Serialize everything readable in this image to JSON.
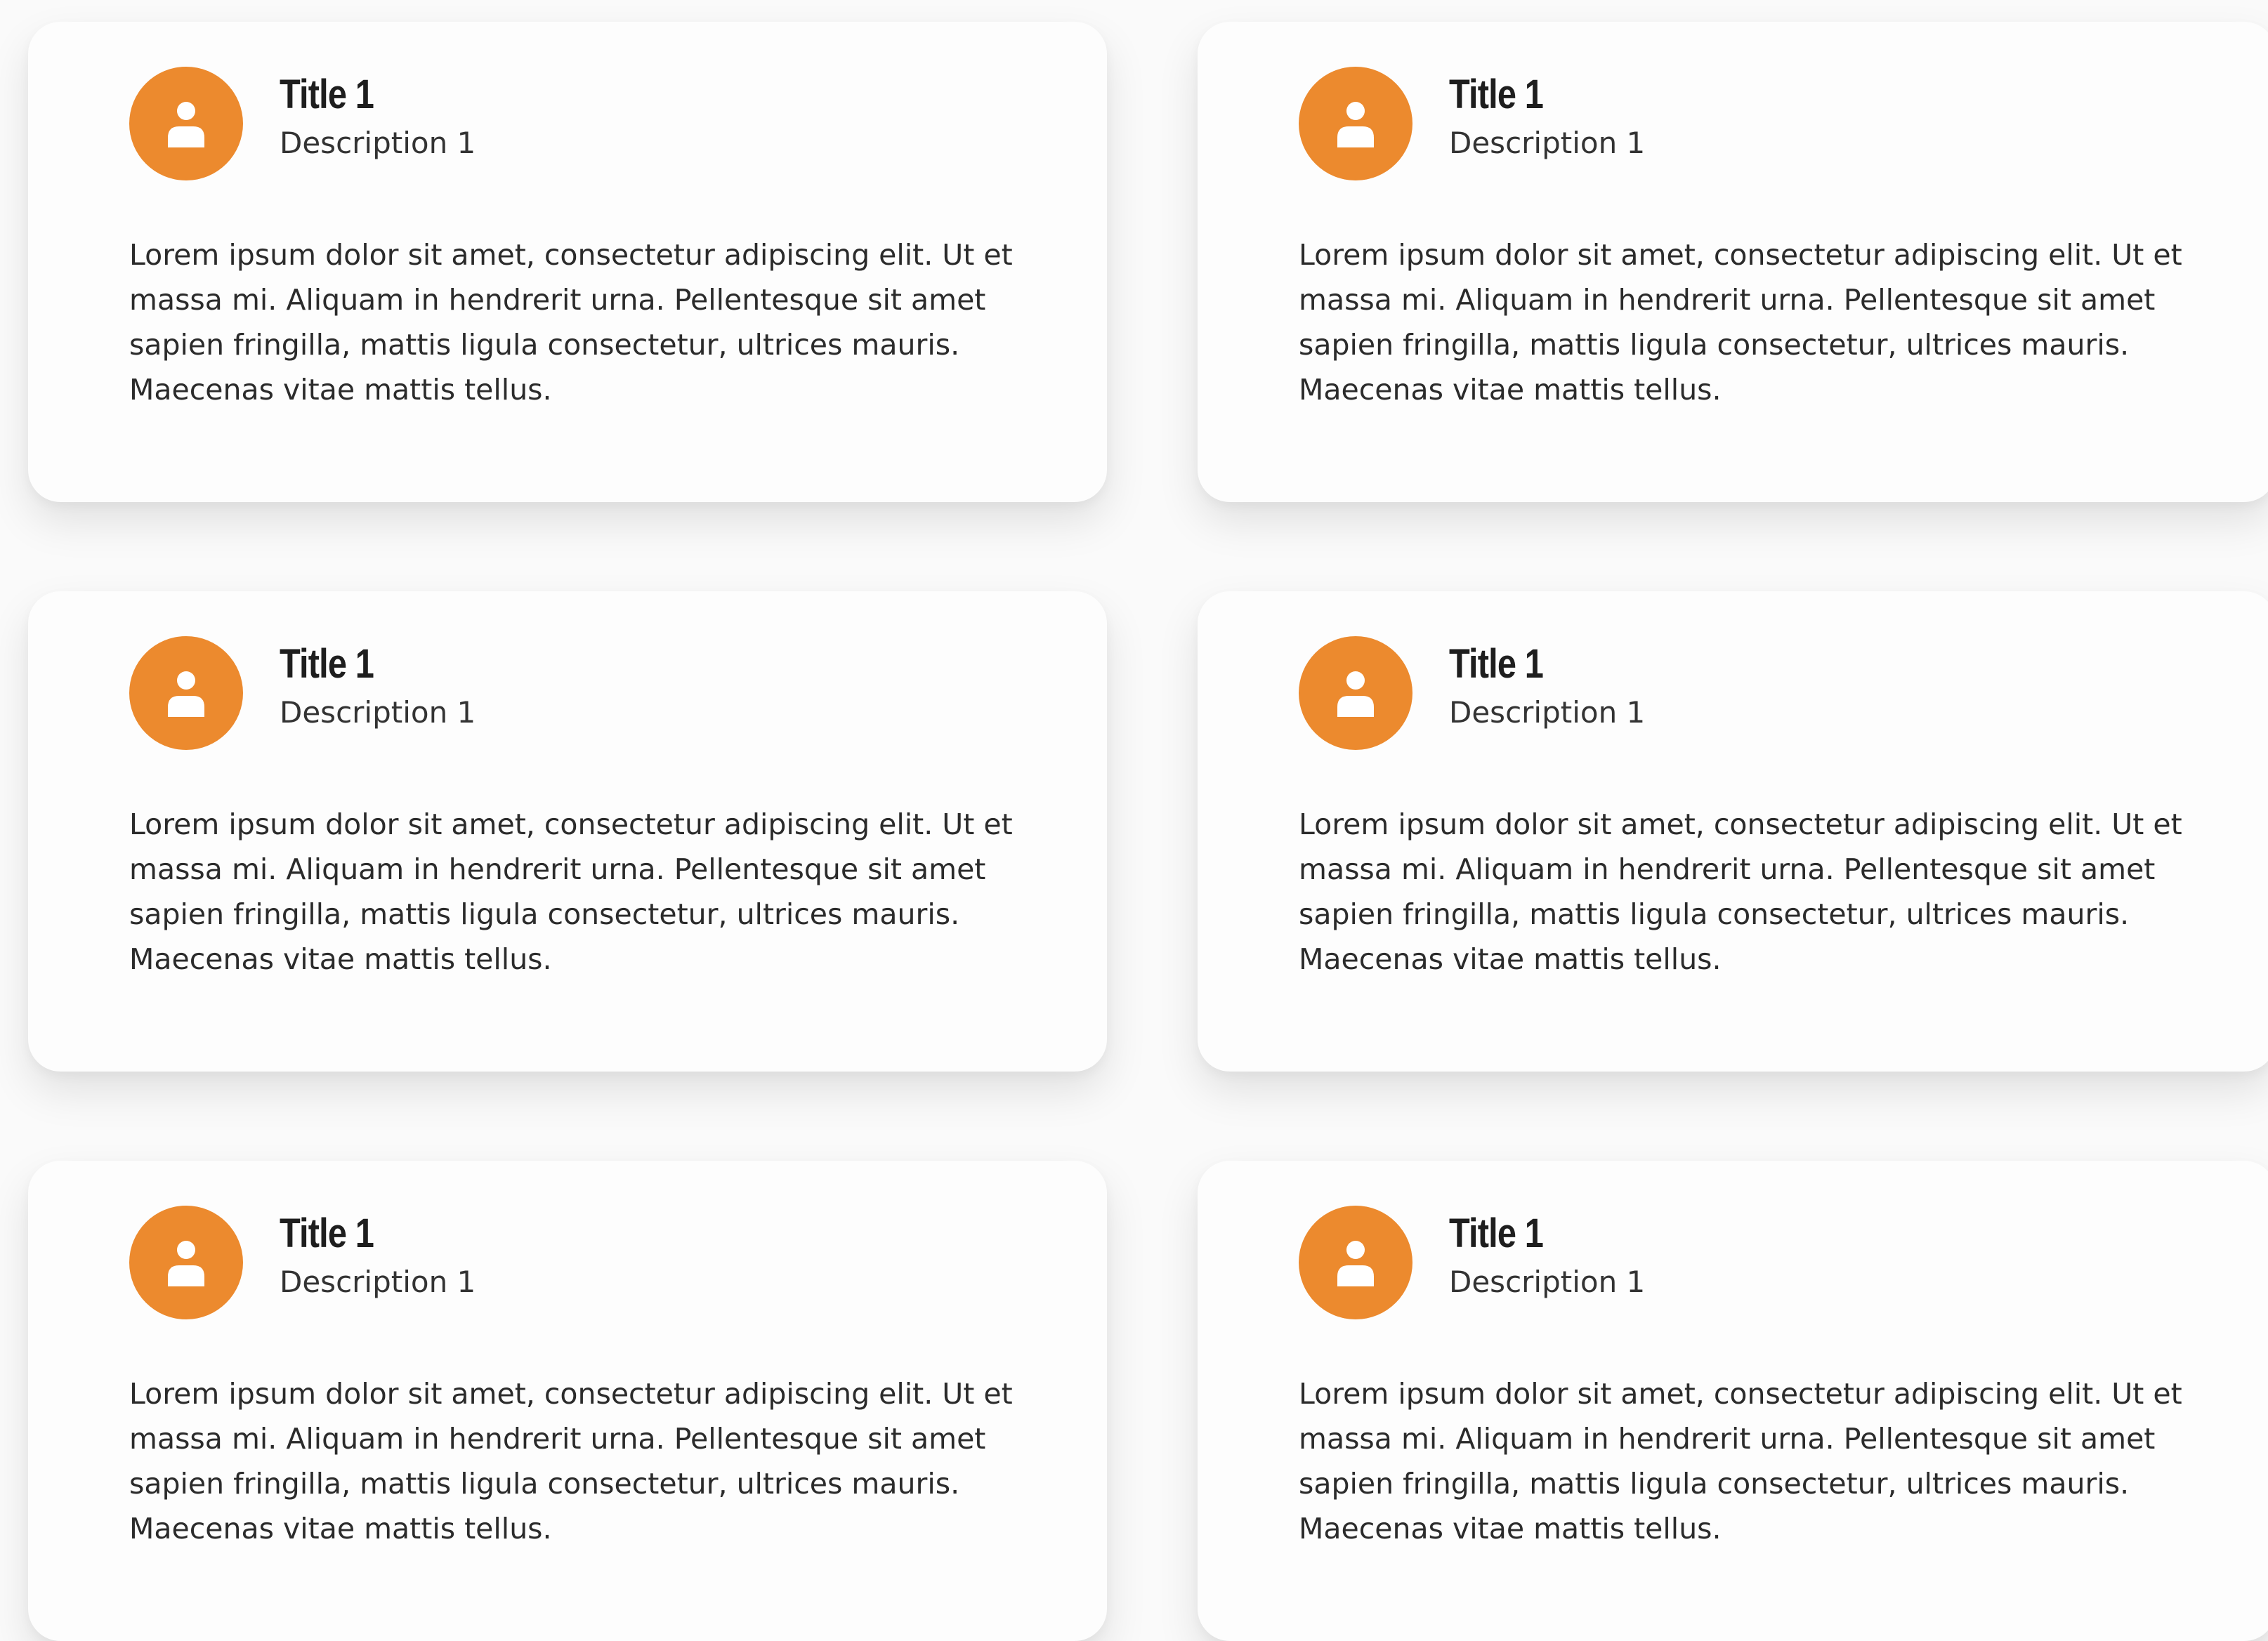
{
  "colors": {
    "accent": "#ec8a2e",
    "background": "#fafafa",
    "card": "#fdfdfd"
  },
  "cards": [
    {
      "icon": "user-icon",
      "title": "Title 1",
      "description": "Description 1",
      "body": "Lorem ipsum dolor sit amet, consectetur adipiscing elit. Ut et massa mi. Aliquam in hendrerit urna. Pellentesque sit amet sapien fringilla, mattis ligula consectetur, ultrices mauris. Maecenas vitae mattis tellus."
    },
    {
      "icon": "user-icon",
      "title": "Title 1",
      "description": "Description 1",
      "body": "Lorem ipsum dolor sit amet, consectetur adipiscing elit. Ut et massa mi. Aliquam in hendrerit urna. Pellentesque sit amet sapien fringilla, mattis ligula consectetur, ultrices mauris. Maecenas vitae mattis tellus."
    },
    {
      "icon": "user-icon",
      "title": "Title 1",
      "description": "Description 1",
      "body": "Lorem ipsum dolor sit amet, consectetur adipiscing elit. Ut et massa mi. Aliquam in hendrerit urna. Pellentesque sit amet sapien fringilla, mattis ligula consectetur, ultrices mauris. Maecenas vitae mattis tellus."
    },
    {
      "icon": "user-icon",
      "title": "Title 1",
      "description": "Description 1",
      "body": "Lorem ipsum dolor sit amet, consectetur adipiscing elit. Ut et massa mi. Aliquam in hendrerit urna. Pellentesque sit amet sapien fringilla, mattis ligula consectetur, ultrices mauris. Maecenas vitae mattis tellus."
    },
    {
      "icon": "user-icon",
      "title": "Title 1",
      "description": "Description 1",
      "body": "Lorem ipsum dolor sit amet, consectetur adipiscing elit. Ut et massa mi. Aliquam in hendrerit urna. Pellentesque sit amet sapien fringilla, mattis ligula consectetur, ultrices mauris. Maecenas vitae mattis tellus."
    },
    {
      "icon": "user-icon",
      "title": "Title 1",
      "description": "Description 1",
      "body": "Lorem ipsum dolor sit amet, consectetur adipiscing elit. Ut et massa mi. Aliquam in hendrerit urna. Pellentesque sit amet sapien fringilla, mattis ligula consectetur, ultrices mauris. Maecenas vitae mattis tellus."
    }
  ]
}
